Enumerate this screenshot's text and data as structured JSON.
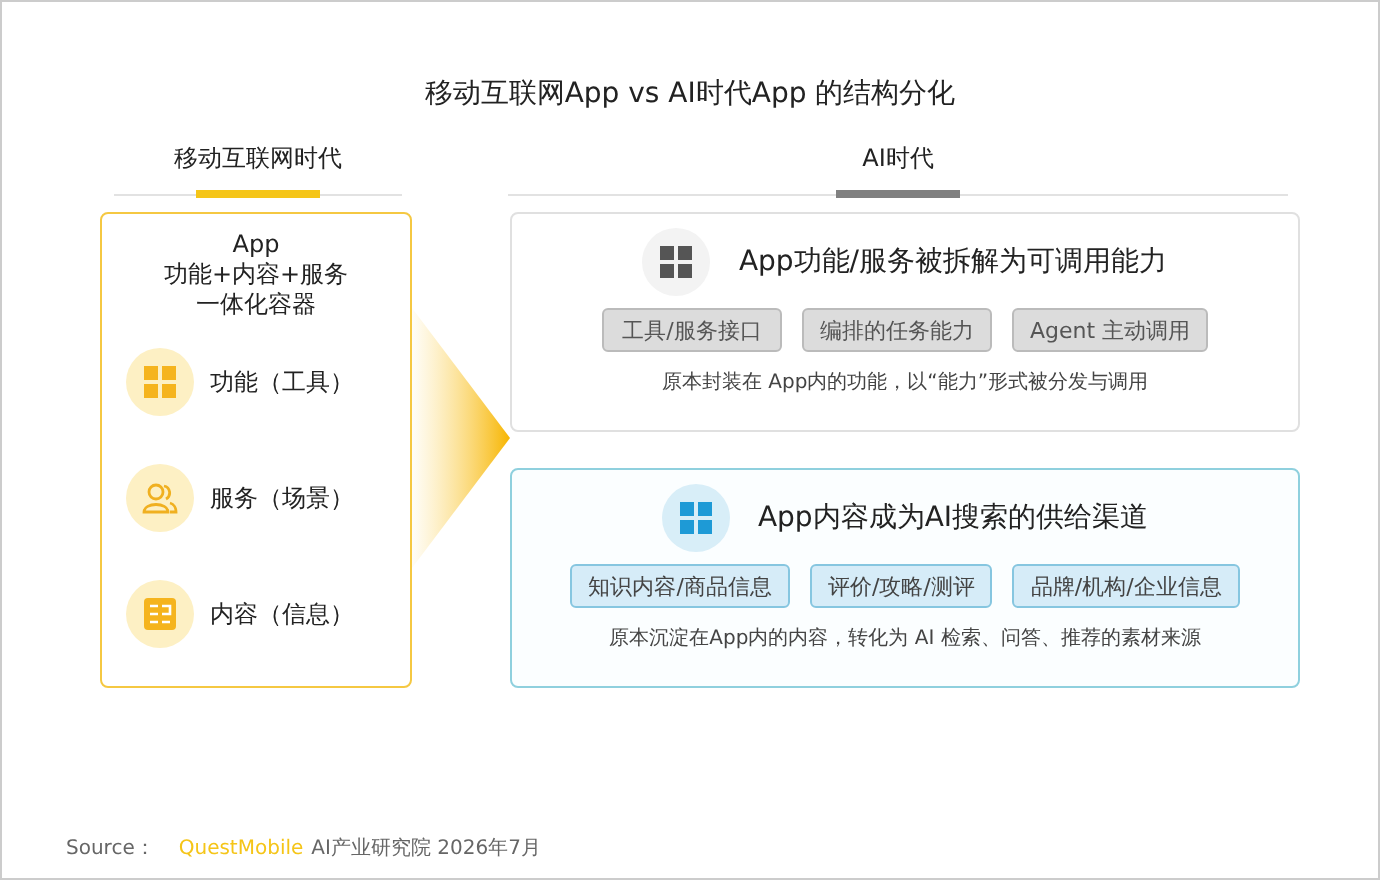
{
  "title": "移动互联网App vs AI时代App 的结构分化",
  "eras": [
    {
      "label": "移动互联网时代",
      "color": "#f5c518"
    },
    {
      "label": "AI时代",
      "color": "#808080"
    }
  ],
  "app_card": {
    "title_lines": [
      "App",
      "功能+内容+服务",
      "一体化容器"
    ],
    "items": [
      {
        "kind": "function",
        "label": "功能（工具）"
      },
      {
        "kind": "service",
        "label": "服务（场景）"
      },
      {
        "kind": "content",
        "label": "内容（信息）"
      }
    ]
  },
  "ai_cards": [
    {
      "kind": "capability",
      "title": "App功能/服务被拆解为可调用能力",
      "tags": [
        "工具/服务接口",
        "编排的任务能力",
        "Agent 主动调用"
      ],
      "note": "原本封装在 App内的功能，以“能力”形式被分发与调用"
    },
    {
      "kind": "content",
      "title": "App内容成为AI搜索的供给渠道",
      "tags": [
        "知识内容/商品信息",
        "评价/攻略/测评",
        "品牌/机构/企业信息"
      ],
      "note": "原本沉淀在App内的内容，转化为 AI 检索、问答、推荐的素材来源"
    }
  ],
  "source": {
    "label": "Source：",
    "brand": "QuestMobile",
    "text": "AI产业研究院 2026年7月"
  }
}
